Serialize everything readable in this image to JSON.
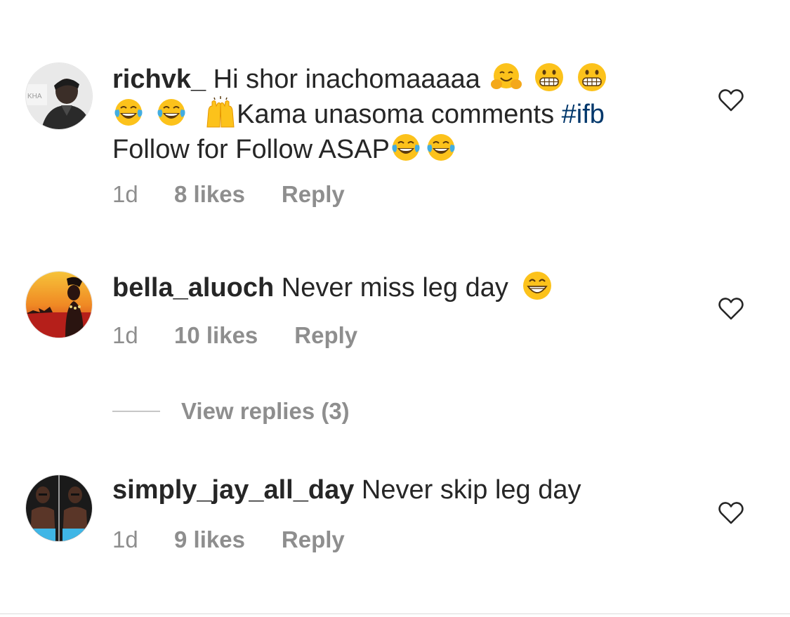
{
  "comments": [
    {
      "username": "richvk_",
      "text_parts": {
        "a": "Hi shor inachomaaaaa",
        "b": "Kama unasoma comments",
        "hashtag": "#ifb",
        "c": "Follow for Follow ASAP"
      },
      "emojis": [
        "hugging-face",
        "grimacing-face",
        "grimacing-face",
        "tears-of-joy",
        "tears-of-joy",
        "raising-hands",
        "tears-of-joy",
        "tears-of-joy"
      ],
      "time": "1d",
      "likes": "8 likes",
      "reply": "Reply"
    },
    {
      "username": "bella_aluoch",
      "text": "Never miss leg day",
      "emojis": [
        "beaming-face"
      ],
      "time": "1d",
      "likes": "10 likes",
      "reply": "Reply",
      "view_replies": "View replies (3)"
    },
    {
      "username": "simply_jay_all_day",
      "text": "Never skip leg day",
      "time": "1d",
      "likes": "9 likes",
      "reply": "Reply"
    }
  ],
  "icons": {
    "like": "heart-outline-icon"
  },
  "colors": {
    "text": "#262626",
    "secondary": "#8e8e8e",
    "hashtag": "#00376b"
  }
}
